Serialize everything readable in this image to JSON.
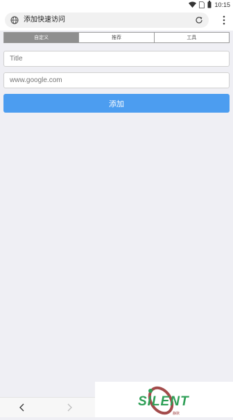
{
  "status": {
    "time": "10:15"
  },
  "topbar": {
    "title": "添加快速访问"
  },
  "tabs": [
    {
      "label": "自定义",
      "active": true
    },
    {
      "label": "推荐",
      "active": false
    },
    {
      "label": "工具",
      "active": false
    }
  ],
  "form": {
    "title_placeholder": "Title",
    "url_placeholder": "www.google.com",
    "add_label": "添加"
  },
  "watermark": {
    "brand": "SILENT",
    "sub": "静默"
  },
  "colors": {
    "accent": "#4c9df0",
    "tab_active": "#8f8f8f",
    "logo_green": "#2e9f56",
    "logo_red": "#a34b4b"
  }
}
